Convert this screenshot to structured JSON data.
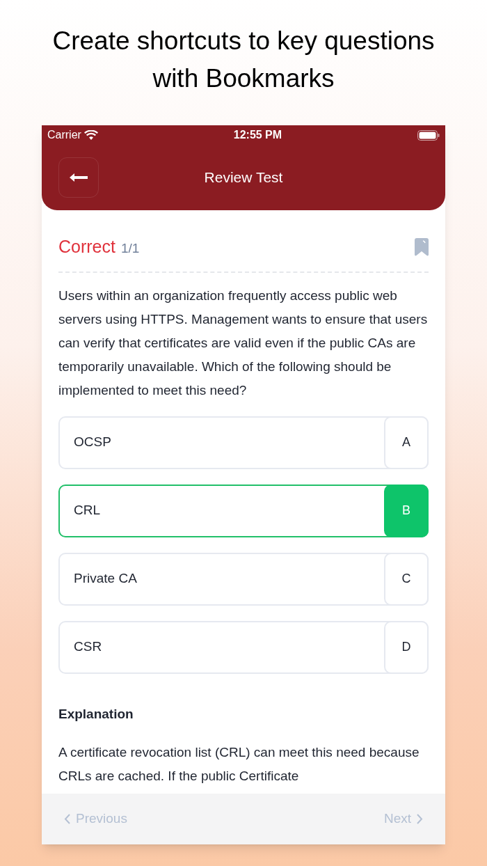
{
  "headline": "Create shortcuts to key questions with Bookmarks",
  "status_bar": {
    "carrier": "Carrier",
    "time": "12:55 PM"
  },
  "header": {
    "title": "Review Test"
  },
  "result": {
    "label": "Correct",
    "count": "1/1",
    "bookmarked": false
  },
  "question": "Users within an organization frequently access public web servers using HTTPS. Management wants to ensure that users can verify that certificates are valid even if the public CAs are temporarily unavailable. Which of the following should be implemented to meet this need?",
  "options": [
    {
      "text": "OCSP",
      "letter": "A",
      "selected": false
    },
    {
      "text": "CRL",
      "letter": "B",
      "selected": true
    },
    {
      "text": "Private CA",
      "letter": "C",
      "selected": false
    },
    {
      "text": "CSR",
      "letter": "D",
      "selected": false
    }
  ],
  "explanation": {
    "heading": "Explanation",
    "text": "A certificate revocation list (CRL) can meet this need because CRLs are cached. If the public Certificate"
  },
  "footer": {
    "previous": "Previous",
    "next": "Next"
  }
}
